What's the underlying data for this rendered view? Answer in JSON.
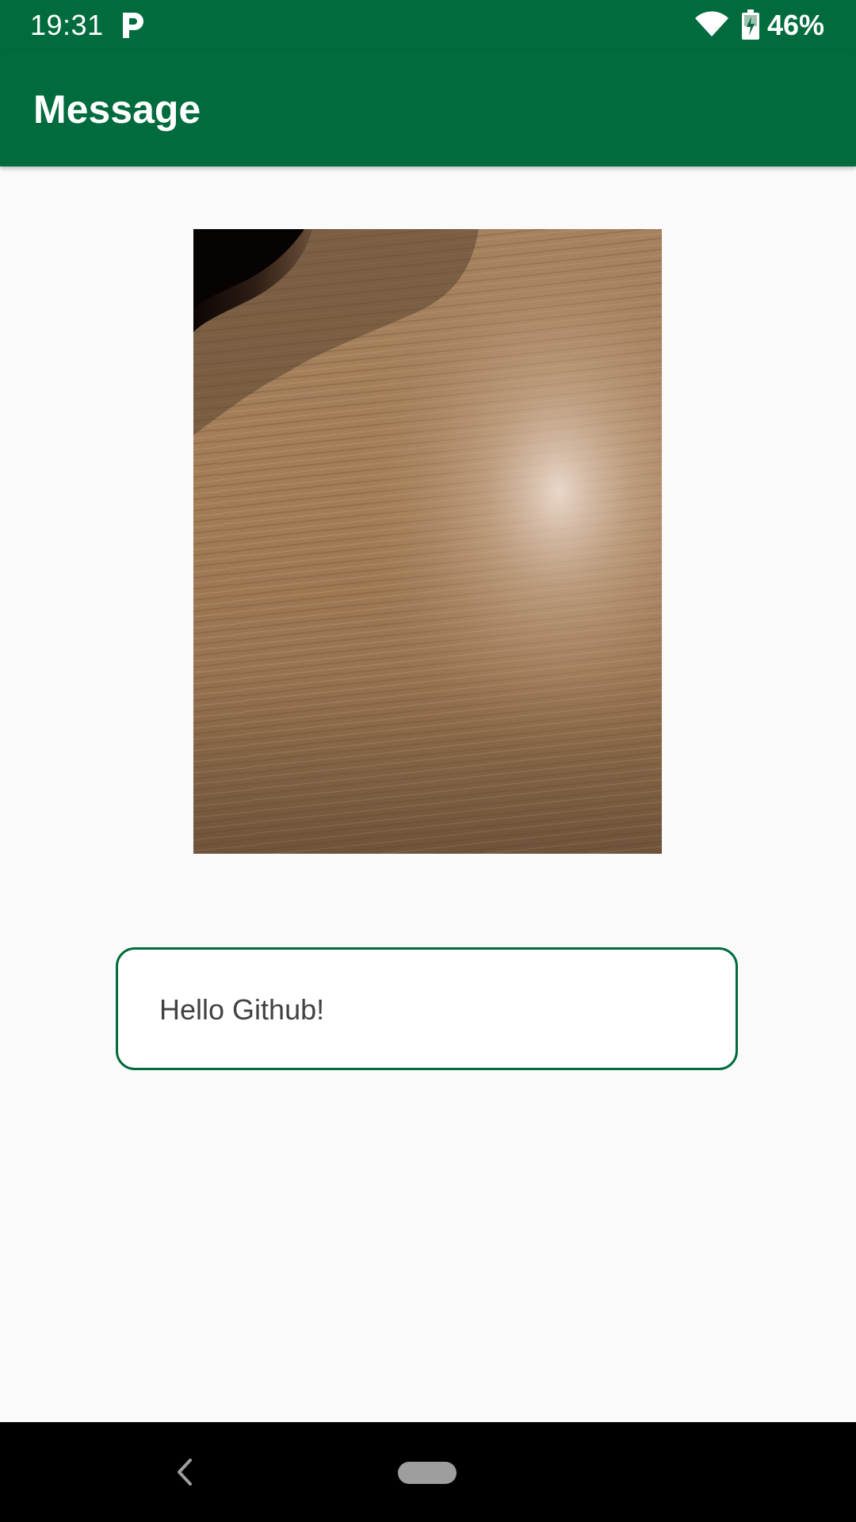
{
  "status_bar": {
    "time": "19:31",
    "battery": "46%",
    "icons": [
      "parking-app-icon",
      "wifi-icon",
      "battery-charging-icon"
    ]
  },
  "app_bar": {
    "title": "Message"
  },
  "content": {
    "photo_icon": "photo-wood-texture",
    "message": "Hello Github!"
  },
  "nav_bar": {
    "icons": [
      "back-icon",
      "home-pill-icon"
    ]
  },
  "colors": {
    "primary": "#006b3d",
    "background": "#fafafa",
    "message_text": "#424242",
    "nav_background": "#000000"
  }
}
